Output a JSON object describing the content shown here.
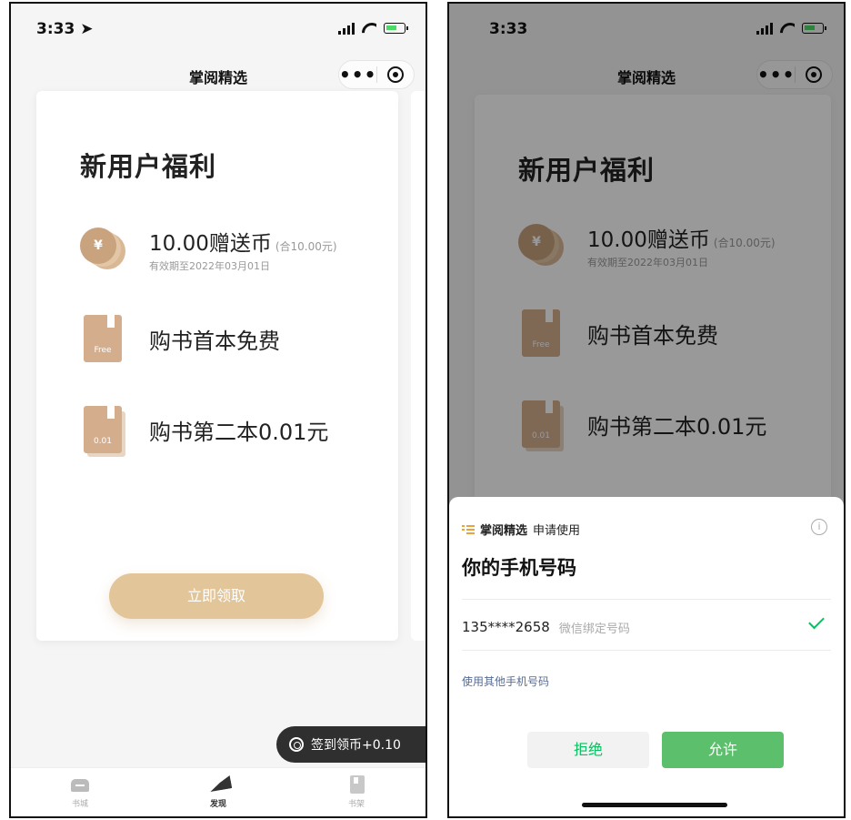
{
  "left": {
    "status": {
      "time": "3:33 ➤"
    },
    "nav": {
      "title": "掌阅精选",
      "more": "•••"
    },
    "card": {
      "title": "新用户福利",
      "coin": {
        "icon_glyph": "¥",
        "main": "10.00赠送币",
        "note": "(合10.00元)",
        "sub": "有效期至2022年03月01日"
      },
      "free_book": {
        "badge": "Free",
        "text": "购书首本免费"
      },
      "second_book": {
        "badge": "0.01",
        "text": "购书第二本0.01元"
      },
      "claim_button": "立即领取"
    },
    "signin": {
      "label": "签到领币+0.10"
    },
    "tabs": [
      {
        "label": "书城",
        "icon": "home-icon"
      },
      {
        "label": "发现",
        "icon": "plane-icon"
      },
      {
        "label": "书架",
        "icon": "shelf-icon"
      }
    ]
  },
  "right": {
    "status": {
      "time": "3:33"
    },
    "nav": {
      "title": "掌阅精选",
      "more": "•••"
    },
    "card": {
      "title": "新用户福利",
      "coin": {
        "icon_glyph": "¥",
        "main": "10.00赠送币",
        "note": "(合10.00元)",
        "sub": "有效期至2022年03月01日"
      },
      "free_book": {
        "badge": "Free",
        "text": "购书首本免费"
      },
      "second_book": {
        "badge": "0.01",
        "text": "购书第二本0.01元"
      }
    },
    "sheet": {
      "app_name": "掌阅精选",
      "action": "申请使用",
      "info_glyph": "i",
      "title": "你的手机号码",
      "phone_number": "135****2658",
      "phone_tag": "微信绑定号码",
      "other_phone": "使用其他手机号码",
      "deny": "拒绝",
      "allow": "允许"
    }
  },
  "colors": {
    "gold": "#e2c598",
    "coin": "#c9a27e",
    "wechat_green": "#07c160",
    "allow_green": "#5cbf6c",
    "link_blue": "#576b95"
  }
}
